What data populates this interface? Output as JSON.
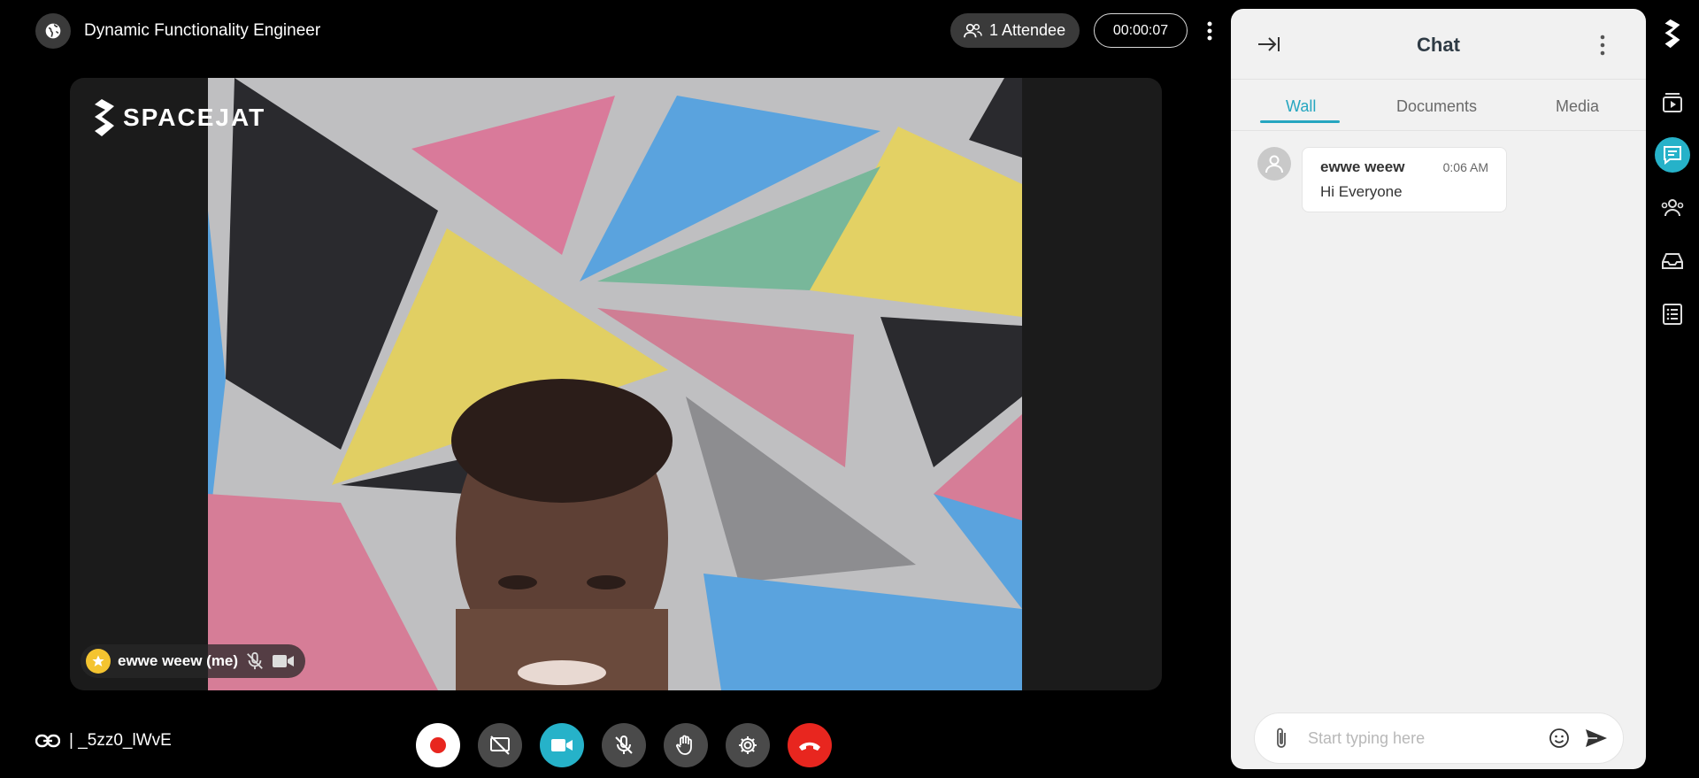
{
  "header": {
    "title": "Dynamic Functionality Engineer",
    "attendee_label": "1 Attendee",
    "timer": "00:00:07"
  },
  "video": {
    "logo_text": "SPACEJAT",
    "participant_label": "ewwe weew (me)"
  },
  "footer": {
    "meeting_code": "|  _5zz0_lWvE",
    "controls": [
      "record",
      "screen-share-off",
      "camera",
      "mic-off",
      "raise-hand",
      "settings",
      "end-call"
    ]
  },
  "chat": {
    "title": "Chat",
    "tabs": [
      {
        "label": "Wall",
        "active": true
      },
      {
        "label": "Documents",
        "active": false
      },
      {
        "label": "Media",
        "active": false
      }
    ],
    "messages": [
      {
        "author": "ewwe weew",
        "time": "0:06 AM",
        "text": "Hi Everyone"
      }
    ],
    "composer_placeholder": "Start typing here"
  },
  "rail": {
    "items": [
      "spacejat-logo-icon",
      "play-icon",
      "chat-icon",
      "people-icon",
      "inbox-icon",
      "list-icon"
    ],
    "active": "chat-icon"
  },
  "colors": {
    "accent": "#26b2c9",
    "end_call": "#e8261f",
    "panel_bg": "#f1f1f1"
  }
}
